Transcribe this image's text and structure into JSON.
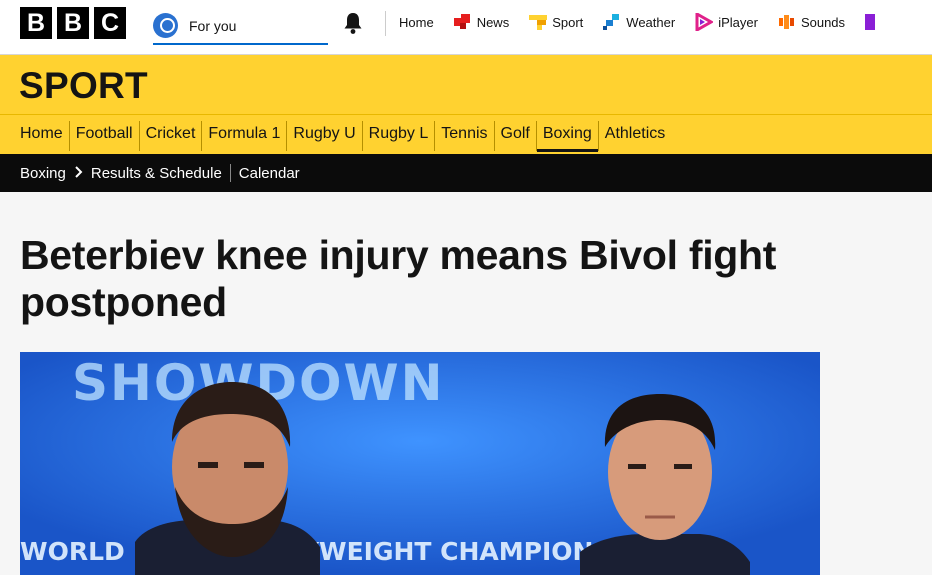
{
  "brand": {
    "letters": [
      "B",
      "B",
      "C"
    ]
  },
  "account": {
    "label": "For you"
  },
  "top_nav": [
    {
      "label": "Home",
      "icon": "none",
      "color": ""
    },
    {
      "label": "News",
      "icon": "news-icon",
      "color": "#e61e1e"
    },
    {
      "label": "Sport",
      "icon": "sport-icon",
      "color": "#ffd230"
    },
    {
      "label": "Weather",
      "icon": "weather-icon",
      "color": "#1b7fd1"
    },
    {
      "label": "iPlayer",
      "icon": "iplayer-icon",
      "color": "#e0218a"
    },
    {
      "label": "Sounds",
      "icon": "sounds-icon",
      "color": "#ff6a00"
    }
  ],
  "section": {
    "title": "SPORT",
    "tabs": [
      "Home",
      "Football",
      "Cricket",
      "Formula 1",
      "Rugby U",
      "Rugby L",
      "Tennis",
      "Golf",
      "Boxing",
      "Athletics"
    ],
    "active_tab": "Boxing"
  },
  "subnav": {
    "crumb": "Boxing",
    "links": [
      "Results & Schedule",
      "Calendar"
    ]
  },
  "article": {
    "headline": "Beterbiev knee injury means Bivol fight postponed",
    "image_text_top": "SHOWDOWN",
    "image_text_bottom": "WORLD LIGHT HEAVYWEIGHT CHAMPIONSHIP"
  },
  "colors": {
    "accent_yellow": "#ffd230",
    "link_blue": "#0068cc"
  }
}
